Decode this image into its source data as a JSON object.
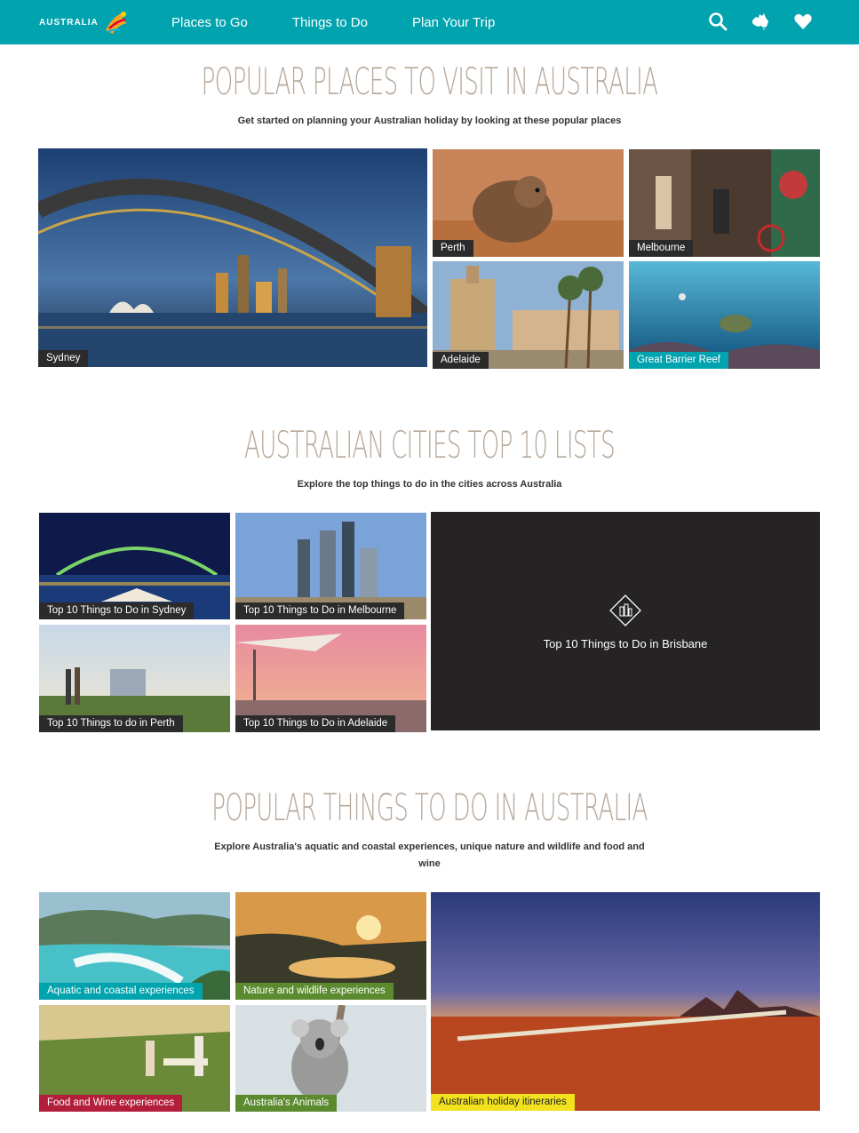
{
  "header": {
    "logo_text": "AUSTRALIA",
    "nav": [
      "Places to Go",
      "Things to Do",
      "Plan Your Trip"
    ],
    "icons": [
      "search-icon",
      "australia-map-icon",
      "heart-icon"
    ],
    "bg_color": "#00a3ae"
  },
  "places": {
    "title": "POPULAR PLACES TO VISIT IN AUSTRALIA",
    "subtitle": "Get started on planning your Australian holiday by looking at these popular places",
    "tiles": [
      "Sydney",
      "Perth",
      "Melbourne",
      "Adelaide",
      "Great Barrier Reef"
    ]
  },
  "cities": {
    "title": "AUSTRALIAN CITIES TOP 10 LISTS",
    "subtitle": "Explore the top things to do in the cities across Australia",
    "tiles": [
      "Top 10 Things to Do in Sydney",
      "Top 10 Things to Do in Melbourne",
      "Top 10 Things to do in Perth",
      "Top 10 Things to Do in Adelaide"
    ],
    "feature": "Top 10 Things to Do in Brisbane"
  },
  "things": {
    "title": "POPULAR THINGS TO DO IN AUSTRALIA",
    "subtitle": "Explore Australia's aquatic and coastal experiences, unique nature and wildlife and food and wine",
    "tiles": [
      "Aquatic and coastal experiences",
      "Nature and wildlife experiences",
      "Food and Wine experiences",
      "Australia's Animals",
      "Australian holiday itineraries"
    ]
  },
  "colors": {
    "label_dark": "#2b2b2b",
    "label_teal": "#00a3ae",
    "label_green": "#5c8a2e",
    "label_red": "#b31f3b",
    "label_yellow": "#f2e21d",
    "title_color": "#b7a89a"
  }
}
